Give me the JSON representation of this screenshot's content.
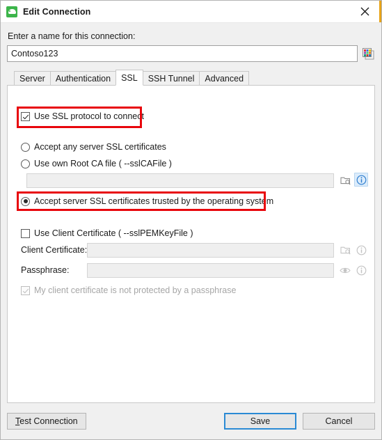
{
  "window": {
    "title": "Edit Connection",
    "app_icon": "database-app-icon",
    "close_icon": "close-icon",
    "accent_color": "#e8a317"
  },
  "connection_name": {
    "label": "Enter a name for this connection:",
    "value": "Contoso123",
    "placeholder": "",
    "palette_icon": "color-palette-icon"
  },
  "tabs": [
    {
      "label": "Server",
      "active": false
    },
    {
      "label": "Authentication",
      "active": false
    },
    {
      "label": "SSL",
      "active": true
    },
    {
      "label": "SSH Tunnel",
      "active": false
    },
    {
      "label": "Advanced",
      "active": false
    }
  ],
  "ssl_panel": {
    "use_ssl": {
      "label": "Use SSL protocol to connect",
      "checked": true,
      "highlighted": true
    },
    "cert_mode": {
      "options": [
        {
          "label": "Accept any server SSL certificates",
          "selected": false,
          "highlighted": false
        },
        {
          "label": "Use own Root CA file ( --sslCAFile )",
          "selected": false,
          "highlighted": false
        },
        {
          "label": "Accept server SSL certificates trusted by the operating system",
          "selected": true,
          "highlighted": true
        }
      ]
    },
    "root_ca_file": {
      "value": "",
      "placeholder": "",
      "browse_icon": "folder-browse-icon",
      "info_icon": "info-icon",
      "info_highlighted": true
    },
    "client_certificate": {
      "use_label": "Use Client Certificate ( --sslPEMKeyFile )",
      "use_checked": false,
      "cert_field_label": "Client Certificate:",
      "cert_value": "",
      "cert_browse_icon": "folder-browse-icon",
      "cert_info_icon": "info-icon",
      "passphrase_label": "Passphrase:",
      "passphrase_value": "",
      "passphrase_reveal_icon": "eye-icon",
      "passphrase_info_icon": "info-icon",
      "no_passphrase_label": "My client certificate is not protected by a passphrase",
      "no_passphrase_checked": true,
      "no_passphrase_disabled": true
    }
  },
  "footer": {
    "test_connection": {
      "label": "Test Connection",
      "mnemonic": "T",
      "rest": "est Connection"
    },
    "save": {
      "label": "Save",
      "focused": true
    },
    "cancel": {
      "label": "Cancel"
    }
  },
  "colors": {
    "annotation_red": "#e8060c",
    "focus_blue": "#2a8ad4",
    "info_blue": "#2f7fd0",
    "app_green": "#3cb54a"
  }
}
